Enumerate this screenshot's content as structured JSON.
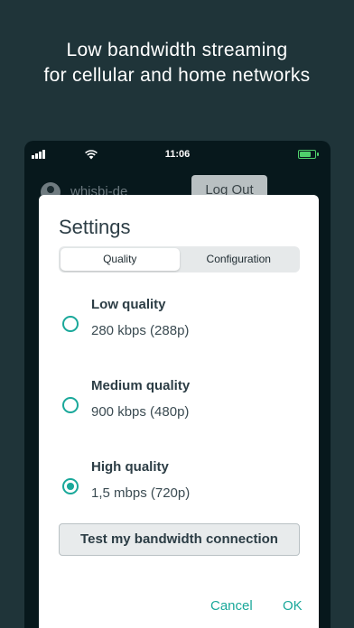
{
  "headline": {
    "line1": "Low bandwidth streaming",
    "line2": "for cellular and home networks"
  },
  "status_bar": {
    "time": "11:06",
    "signal_icon": "cellular-signal-icon",
    "wifi_icon": "wifi-icon",
    "battery_icon": "battery-charging-icon",
    "battery_color": "#4fd06b"
  },
  "account": {
    "username": "whisbi-de",
    "logout_label": "Log Out",
    "avatar_icon": "user-avatar-icon"
  },
  "dialog": {
    "title": "Settings",
    "tabs": [
      {
        "label": "Quality",
        "selected": true
      },
      {
        "label": "Configuration",
        "selected": false
      }
    ],
    "options": [
      {
        "title": "Low quality",
        "detail": "280 kbps (288p)",
        "selected": false
      },
      {
        "title": "Medium quality",
        "detail": "900 kbps (480p)",
        "selected": false
      },
      {
        "title": "High quality",
        "detail": "1,5 mbps (720p)",
        "selected": true
      }
    ],
    "test_button_label": "Test my bandwidth connection",
    "cancel_label": "Cancel",
    "ok_label": "OK"
  },
  "colors": {
    "background": "#1f3439",
    "accent": "#1aa89a"
  }
}
